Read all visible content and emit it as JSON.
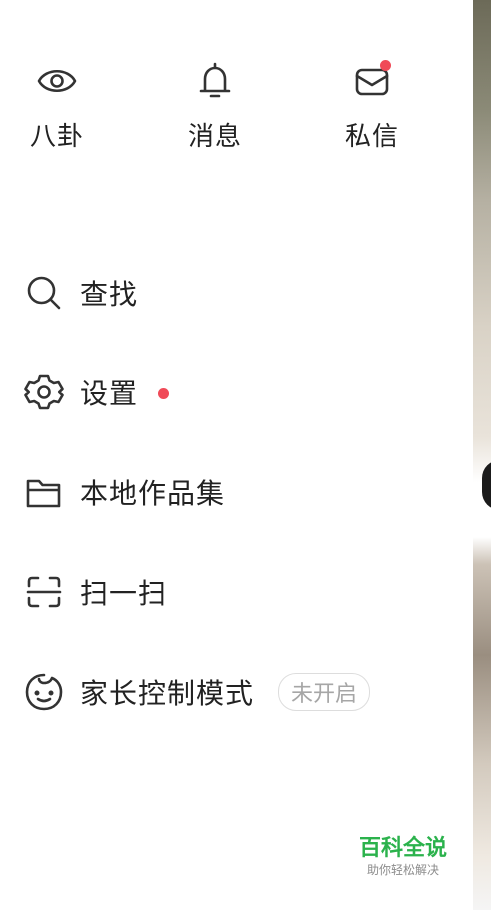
{
  "top_actions": [
    {
      "label": "八卦",
      "icon": "eye-icon"
    },
    {
      "label": "消息",
      "icon": "bell-icon"
    },
    {
      "label": "私信",
      "icon": "mail-icon",
      "badge_color": "#f04a58"
    }
  ],
  "menu": {
    "search": {
      "label": "查找",
      "icon": "search-icon"
    },
    "settings": {
      "label": "设置",
      "icon": "gear-icon",
      "badge_color": "#f04a58"
    },
    "local_works": {
      "label": "本地作品集",
      "icon": "folder-icon"
    },
    "scan": {
      "label": "扫一扫",
      "icon": "scan-icon"
    },
    "parental": {
      "label": "家长控制模式",
      "icon": "smiley-icon",
      "status": "未开启"
    }
  },
  "watermark": {
    "title": "百科全说",
    "subtitle": "助你轻松解决"
  },
  "colors": {
    "accent_dot": "#f04a58",
    "text": "#222222",
    "watermark_green": "#2bb24c"
  }
}
